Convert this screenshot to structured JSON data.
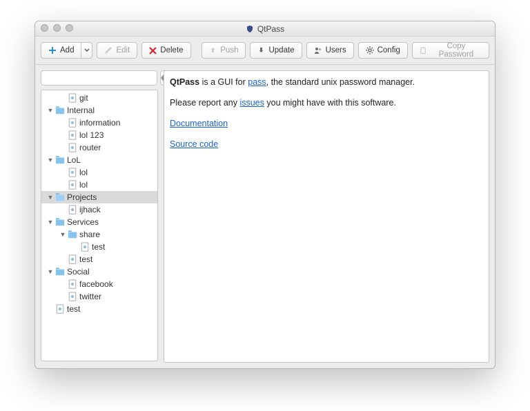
{
  "window": {
    "title": "QtPass"
  },
  "toolbar": {
    "add": "Add",
    "edit": "Edit",
    "delete": "Delete",
    "push": "Push",
    "update": "Update",
    "users": "Users",
    "config": "Config",
    "copy": "Copy Password"
  },
  "search": {
    "value": "",
    "placeholder": ""
  },
  "tree": [
    {
      "d": 1,
      "t": "file",
      "l": "git"
    },
    {
      "d": 0,
      "t": "folder",
      "l": "Internal",
      "open": true
    },
    {
      "d": 1,
      "t": "file",
      "l": "information"
    },
    {
      "d": 1,
      "t": "file",
      "l": "lol 123"
    },
    {
      "d": 1,
      "t": "file",
      "l": "router"
    },
    {
      "d": 0,
      "t": "folder",
      "l": "LoL",
      "open": true
    },
    {
      "d": 1,
      "t": "file",
      "l": "lol"
    },
    {
      "d": 1,
      "t": "file",
      "l": "lol"
    },
    {
      "d": 0,
      "t": "folder",
      "l": "Projects",
      "open": true,
      "selected": true
    },
    {
      "d": 1,
      "t": "file",
      "l": "ijhack"
    },
    {
      "d": 0,
      "t": "folder",
      "l": "Services",
      "open": true
    },
    {
      "d": 1,
      "t": "folder",
      "l": "share",
      "open": true
    },
    {
      "d": 2,
      "t": "file",
      "l": "test"
    },
    {
      "d": 1,
      "t": "file",
      "l": "test"
    },
    {
      "d": 0,
      "t": "folder",
      "l": "Social",
      "open": true
    },
    {
      "d": 1,
      "t": "file",
      "l": "facebook"
    },
    {
      "d": 1,
      "t": "file",
      "l": "twitter"
    },
    {
      "d": 0,
      "t": "file",
      "l": "test"
    }
  ],
  "content": {
    "intro_pre": "QtPass",
    "intro_mid": " is a GUI for ",
    "intro_link": "pass",
    "intro_post": ", the standard unix password manager.",
    "report_pre": "Please report any ",
    "report_link": "issues",
    "report_post": " you might have with this software.",
    "doc": "Documentation",
    "src": "Source code"
  }
}
